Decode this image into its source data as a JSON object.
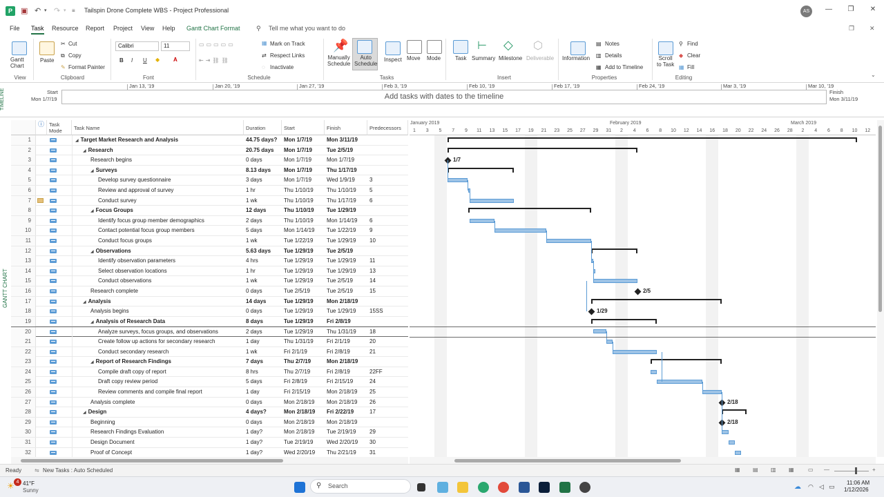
{
  "window": {
    "title": "Tailspin Drone Complete WBS  -  Project Professional",
    "user_initials": "AS"
  },
  "menu": [
    "File",
    "Task",
    "Resource",
    "Report",
    "Project",
    "View",
    "Help",
    "Gantt Chart Format"
  ],
  "tell_me": "Tell me what you want to do",
  "ribbon": {
    "view": {
      "gantt_chart": "Gantt\nChart",
      "group": "View"
    },
    "clipboard": {
      "paste": "Paste",
      "cut": "Cut",
      "copy": "Copy",
      "format_painter": "Format Painter",
      "group": "Clipboard"
    },
    "font": {
      "family": "Calibri",
      "size": "11",
      "bold": "B",
      "italic": "I",
      "underline": "U",
      "group": "Font"
    },
    "schedule": {
      "mark_on_track": "Mark on Track",
      "respect_links": "Respect Links",
      "inactivate": "Inactivate",
      "group": "Schedule"
    },
    "tasks": {
      "manually_schedule": "Manually\nSchedule",
      "auto_schedule": "Auto\nSchedule",
      "inspect": "Inspect",
      "move": "Move",
      "mode": "Mode",
      "group": "Tasks"
    },
    "insert": {
      "task": "Task",
      "summary": "Summary",
      "milestone": "Milestone",
      "deliverable": "Deliverable",
      "group": "Insert"
    },
    "properties": {
      "information": "Information",
      "notes": "Notes",
      "details": "Details",
      "add_to_timeline": "Add to Timeline",
      "group": "Properties"
    },
    "editing": {
      "scroll_to_task": "Scroll\nto Task",
      "find": "Find",
      "clear": "Clear",
      "fill": "Fill",
      "group": "Editing"
    }
  },
  "timeline": {
    "side_label": "TIMELINE",
    "start_label": "Start",
    "start_date": "Mon 1/7/19",
    "finish_label": "Finish",
    "finish_date": "Mon 3/11/19",
    "message": "Add tasks with dates to the timeline",
    "dates": [
      "Jan 13, '19",
      "Jan 20, '19",
      "Jan 27, '19",
      "Feb 3, '19",
      "Feb 10, '19",
      "Feb 17, '19",
      "Feb 24, '19",
      "Mar 3, '19",
      "Mar 10, '19"
    ]
  },
  "gantt_side_label": "GANTT CHART",
  "columns": {
    "info": "ⓘ",
    "mode": "Task\nMode",
    "name": "Task Name",
    "duration": "Duration",
    "start": "Start",
    "finish": "Finish",
    "predecessors": "Predecessors"
  },
  "tasks": [
    {
      "id": "1",
      "name": "Target Market Research and Analysis",
      "dur": "44.75 days?",
      "start": "Mon 1/7/19",
      "finish": "Mon 3/11/19",
      "pred": "",
      "level": 0,
      "summary": true
    },
    {
      "id": "2",
      "name": "Research",
      "dur": "20.75 days",
      "start": "Mon 1/7/19",
      "finish": "Tue 2/5/19",
      "pred": "",
      "level": 1,
      "summary": true
    },
    {
      "id": "3",
      "name": "Research begins",
      "dur": "0 days",
      "start": "Mon 1/7/19",
      "finish": "Mon 1/7/19",
      "pred": "",
      "level": 2,
      "summary": false
    },
    {
      "id": "4",
      "name": "Surveys",
      "dur": "8.13 days",
      "start": "Mon 1/7/19",
      "finish": "Thu 1/17/19",
      "pred": "",
      "level": 2,
      "summary": true
    },
    {
      "id": "5",
      "name": "Develop survey questionnaire",
      "dur": "3 days",
      "start": "Mon 1/7/19",
      "finish": "Wed 1/9/19",
      "pred": "3",
      "level": 3,
      "summary": false
    },
    {
      "id": "6",
      "name": "Review and approval of survey",
      "dur": "1 hr",
      "start": "Thu 1/10/19",
      "finish": "Thu 1/10/19",
      "pred": "5",
      "level": 3,
      "summary": false
    },
    {
      "id": "7",
      "name": "Conduct survey",
      "dur": "1 wk",
      "start": "Thu 1/10/19",
      "finish": "Thu 1/17/19",
      "pred": "6",
      "level": 3,
      "summary": false,
      "note": true
    },
    {
      "id": "8",
      "name": "Focus Groups",
      "dur": "12 days",
      "start": "Thu 1/10/19",
      "finish": "Tue 1/29/19",
      "pred": "",
      "level": 2,
      "summary": true
    },
    {
      "id": "9",
      "name": "Identify focus group member demographics",
      "dur": "2 days",
      "start": "Thu 1/10/19",
      "finish": "Mon 1/14/19",
      "pred": "6",
      "level": 3,
      "summary": false
    },
    {
      "id": "10",
      "name": "Contact potential focus group members",
      "dur": "5 days",
      "start": "Mon 1/14/19",
      "finish": "Tue 1/22/19",
      "pred": "9",
      "level": 3,
      "summary": false
    },
    {
      "id": "11",
      "name": "Conduct focus groups",
      "dur": "1 wk",
      "start": "Tue 1/22/19",
      "finish": "Tue 1/29/19",
      "pred": "10",
      "level": 3,
      "summary": false
    },
    {
      "id": "12",
      "name": "Observations",
      "dur": "5.63 days",
      "start": "Tue 1/29/19",
      "finish": "Tue 2/5/19",
      "pred": "",
      "level": 2,
      "summary": true
    },
    {
      "id": "13",
      "name": "Identify observation parameters",
      "dur": "4 hrs",
      "start": "Tue 1/29/19",
      "finish": "Tue 1/29/19",
      "pred": "11",
      "level": 3,
      "summary": false
    },
    {
      "id": "14",
      "name": "Select observation locations",
      "dur": "1 hr",
      "start": "Tue 1/29/19",
      "finish": "Tue 1/29/19",
      "pred": "13",
      "level": 3,
      "summary": false
    },
    {
      "id": "15",
      "name": "Conduct observations",
      "dur": "1 wk",
      "start": "Tue 1/29/19",
      "finish": "Tue 2/5/19",
      "pred": "14",
      "level": 3,
      "summary": false
    },
    {
      "id": "16",
      "name": "Research complete",
      "dur": "0 days",
      "start": "Tue 2/5/19",
      "finish": "Tue 2/5/19",
      "pred": "15",
      "level": 2,
      "summary": false
    },
    {
      "id": "17",
      "name": "Analysis",
      "dur": "14 days",
      "start": "Tue 1/29/19",
      "finish": "Mon 2/18/19",
      "pred": "",
      "level": 1,
      "summary": true
    },
    {
      "id": "18",
      "name": "Analysis begins",
      "dur": "0 days",
      "start": "Tue 1/29/19",
      "finish": "Tue 1/29/19",
      "pred": "15SS",
      "level": 2,
      "summary": false
    },
    {
      "id": "19",
      "name": "Analysis of Research Data",
      "dur": "8 days",
      "start": "Tue 1/29/19",
      "finish": "Fri 2/8/19",
      "pred": "",
      "level": 2,
      "summary": true
    },
    {
      "id": "20",
      "name": "Analyze surveys, focus groups, and observations",
      "dur": "2 days",
      "start": "Tue 1/29/19",
      "finish": "Thu 1/31/19",
      "pred": "18",
      "level": 3,
      "summary": false,
      "selected": true
    },
    {
      "id": "21",
      "name": "Create follow up actions for secondary research",
      "dur": "1 day",
      "start": "Thu 1/31/19",
      "finish": "Fri 2/1/19",
      "pred": "20",
      "level": 3,
      "summary": false
    },
    {
      "id": "22",
      "name": "Conduct secondary research",
      "dur": "1 wk",
      "start": "Fri 2/1/19",
      "finish": "Fri 2/8/19",
      "pred": "21",
      "level": 3,
      "summary": false
    },
    {
      "id": "23",
      "name": "Report of Research Findings",
      "dur": "7 days",
      "start": "Thu 2/7/19",
      "finish": "Mon 2/18/19",
      "pred": "",
      "level": 2,
      "summary": true
    },
    {
      "id": "24",
      "name": "Compile draft copy of report",
      "dur": "8 hrs",
      "start": "Thu 2/7/19",
      "finish": "Fri 2/8/19",
      "pred": "22FF",
      "level": 3,
      "summary": false
    },
    {
      "id": "25",
      "name": "Draft copy review period",
      "dur": "5 days",
      "start": "Fri 2/8/19",
      "finish": "Fri 2/15/19",
      "pred": "24",
      "level": 3,
      "summary": false
    },
    {
      "id": "26",
      "name": "Review comments and compile final report",
      "dur": "1 day",
      "start": "Fri 2/15/19",
      "finish": "Mon 2/18/19",
      "pred": "25",
      "level": 3,
      "summary": false
    },
    {
      "id": "27",
      "name": "Analysis complete",
      "dur": "0 days",
      "start": "Mon 2/18/19",
      "finish": "Mon 2/18/19",
      "pred": "26",
      "level": 2,
      "summary": false
    },
    {
      "id": "28",
      "name": "Design",
      "dur": "4 days?",
      "start": "Mon 2/18/19",
      "finish": "Fri 2/22/19",
      "pred": "17",
      "level": 1,
      "summary": true
    },
    {
      "id": "29",
      "name": "Beginning",
      "dur": "0 days",
      "start": "Mon 2/18/19",
      "finish": "Mon 2/18/19",
      "pred": "",
      "level": 2,
      "summary": false
    },
    {
      "id": "30",
      "name": "Research Findings Evaluation",
      "dur": "1 day?",
      "start": "Mon 2/18/19",
      "finish": "Tue 2/19/19",
      "pred": "29",
      "level": 2,
      "summary": false
    },
    {
      "id": "31",
      "name": "Design Document",
      "dur": "1 day?",
      "start": "Tue 2/19/19",
      "finish": "Wed 2/20/19",
      "pred": "30",
      "level": 2,
      "summary": false
    },
    {
      "id": "32",
      "name": "Proof of Concept",
      "dur": "1 day?",
      "start": "Wed 2/20/19",
      "finish": "Thu 2/21/19",
      "pred": "31",
      "level": 2,
      "summary": false
    }
  ],
  "chart": {
    "months": [
      "January 2019",
      "February 2019",
      "March 2019"
    ],
    "days": [
      "1",
      "3",
      "5",
      "7",
      "9",
      "11",
      "13",
      "15",
      "17",
      "19",
      "21",
      "23",
      "25",
      "27",
      "29",
      "31",
      "2",
      "4",
      "6",
      "8",
      "10",
      "12",
      "14",
      "16",
      "18",
      "20",
      "22",
      "24",
      "26",
      "28",
      "2",
      "4",
      "6",
      "8",
      "10",
      "12"
    ],
    "milestone_labels": {
      "m3": "1/7",
      "m16": "2/5",
      "m18": "1/29",
      "m27": "2/18",
      "m29": "2/18"
    },
    "bar_color": "#9dc3e6",
    "bar_border": "#5b9bd5"
  },
  "status": {
    "ready": "Ready",
    "new_tasks": "New Tasks : Auto Scheduled"
  },
  "taskbar": {
    "weather_temp": "41°F",
    "weather_cond": "Sunny",
    "search": "Search",
    "time": "11:06 AM",
    "date": "1/12/2026",
    "notification_count": "4"
  }
}
